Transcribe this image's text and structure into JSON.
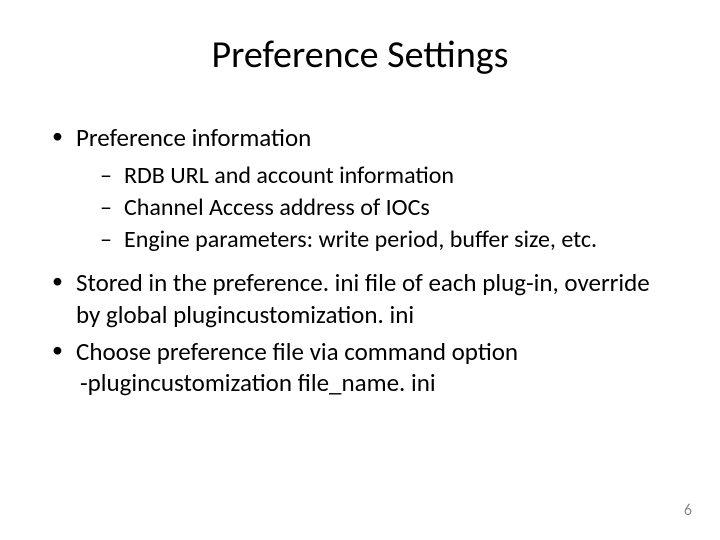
{
  "title": "Preference Settings",
  "bullets": {
    "b1": "Preference information",
    "b1_sub": {
      "s1": "RDB URL and account information",
      "s2": "Channel Access address of IOCs",
      "s3": "Engine parameters: write period, buffer size, etc."
    },
    "b2": "Stored in the preference. ini file of each plug-in, override by global plugincustomization. ini",
    "b3": "Choose preference file via command option",
    "b3_line2": "-plugincustomization file_name. ini"
  },
  "page_number": "6"
}
